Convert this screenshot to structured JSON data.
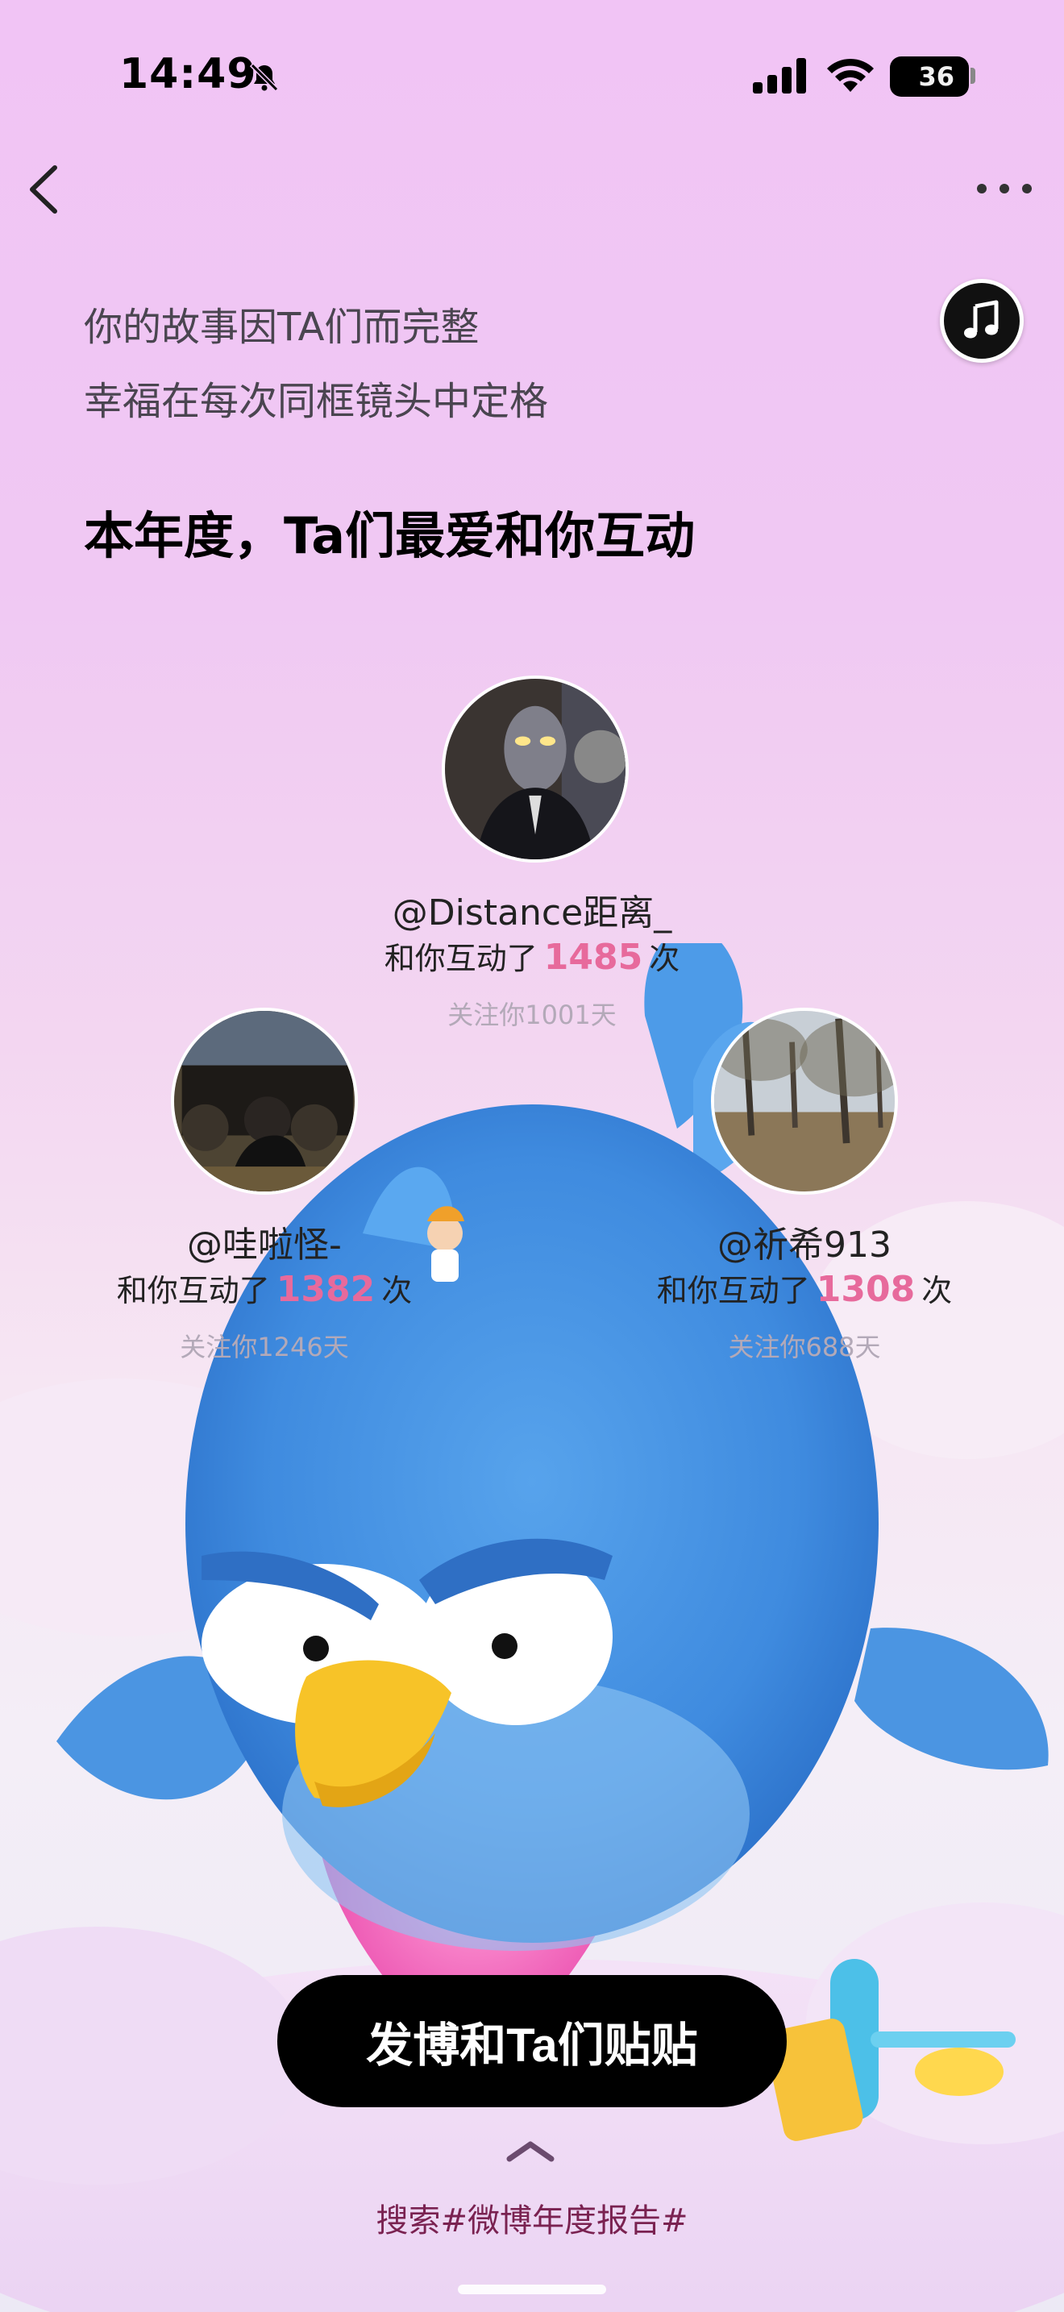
{
  "status": {
    "time": "14:49",
    "battery": "36"
  },
  "intro": {
    "line1": "你的故事因TA们而完整",
    "line2": "幸福在每次同框镜头中定格",
    "heading": "本年度，Ta们最爱和你互动"
  },
  "friends": [
    {
      "name": "@Distance距离_",
      "interact_prefix": "和你互动了",
      "count": "1485",
      "interact_suffix": "次",
      "follow": "关注你1001天"
    },
    {
      "name": "@哇啦怪-",
      "interact_prefix": "和你互动了",
      "count": "1382",
      "interact_suffix": "次",
      "follow": "关注你1246天"
    },
    {
      "name": "@祈希913",
      "interact_prefix": "和你互动了",
      "count": "1308",
      "interact_suffix": "次",
      "follow": "关注你688天"
    }
  ],
  "cta": {
    "label": "发博和Ta们贴贴"
  },
  "footer": {
    "search": "搜索#微博年度报告#"
  },
  "icons": {
    "back": "back-arrow-icon",
    "more": "more-icon",
    "music": "music-note-icon",
    "bell": "bell-muted-icon",
    "signal": "signal-icon",
    "wifi": "wifi-icon"
  },
  "colors": {
    "accent_count": "#e76a9c",
    "cta_bg": "#000000",
    "search_text": "#7a2251"
  }
}
